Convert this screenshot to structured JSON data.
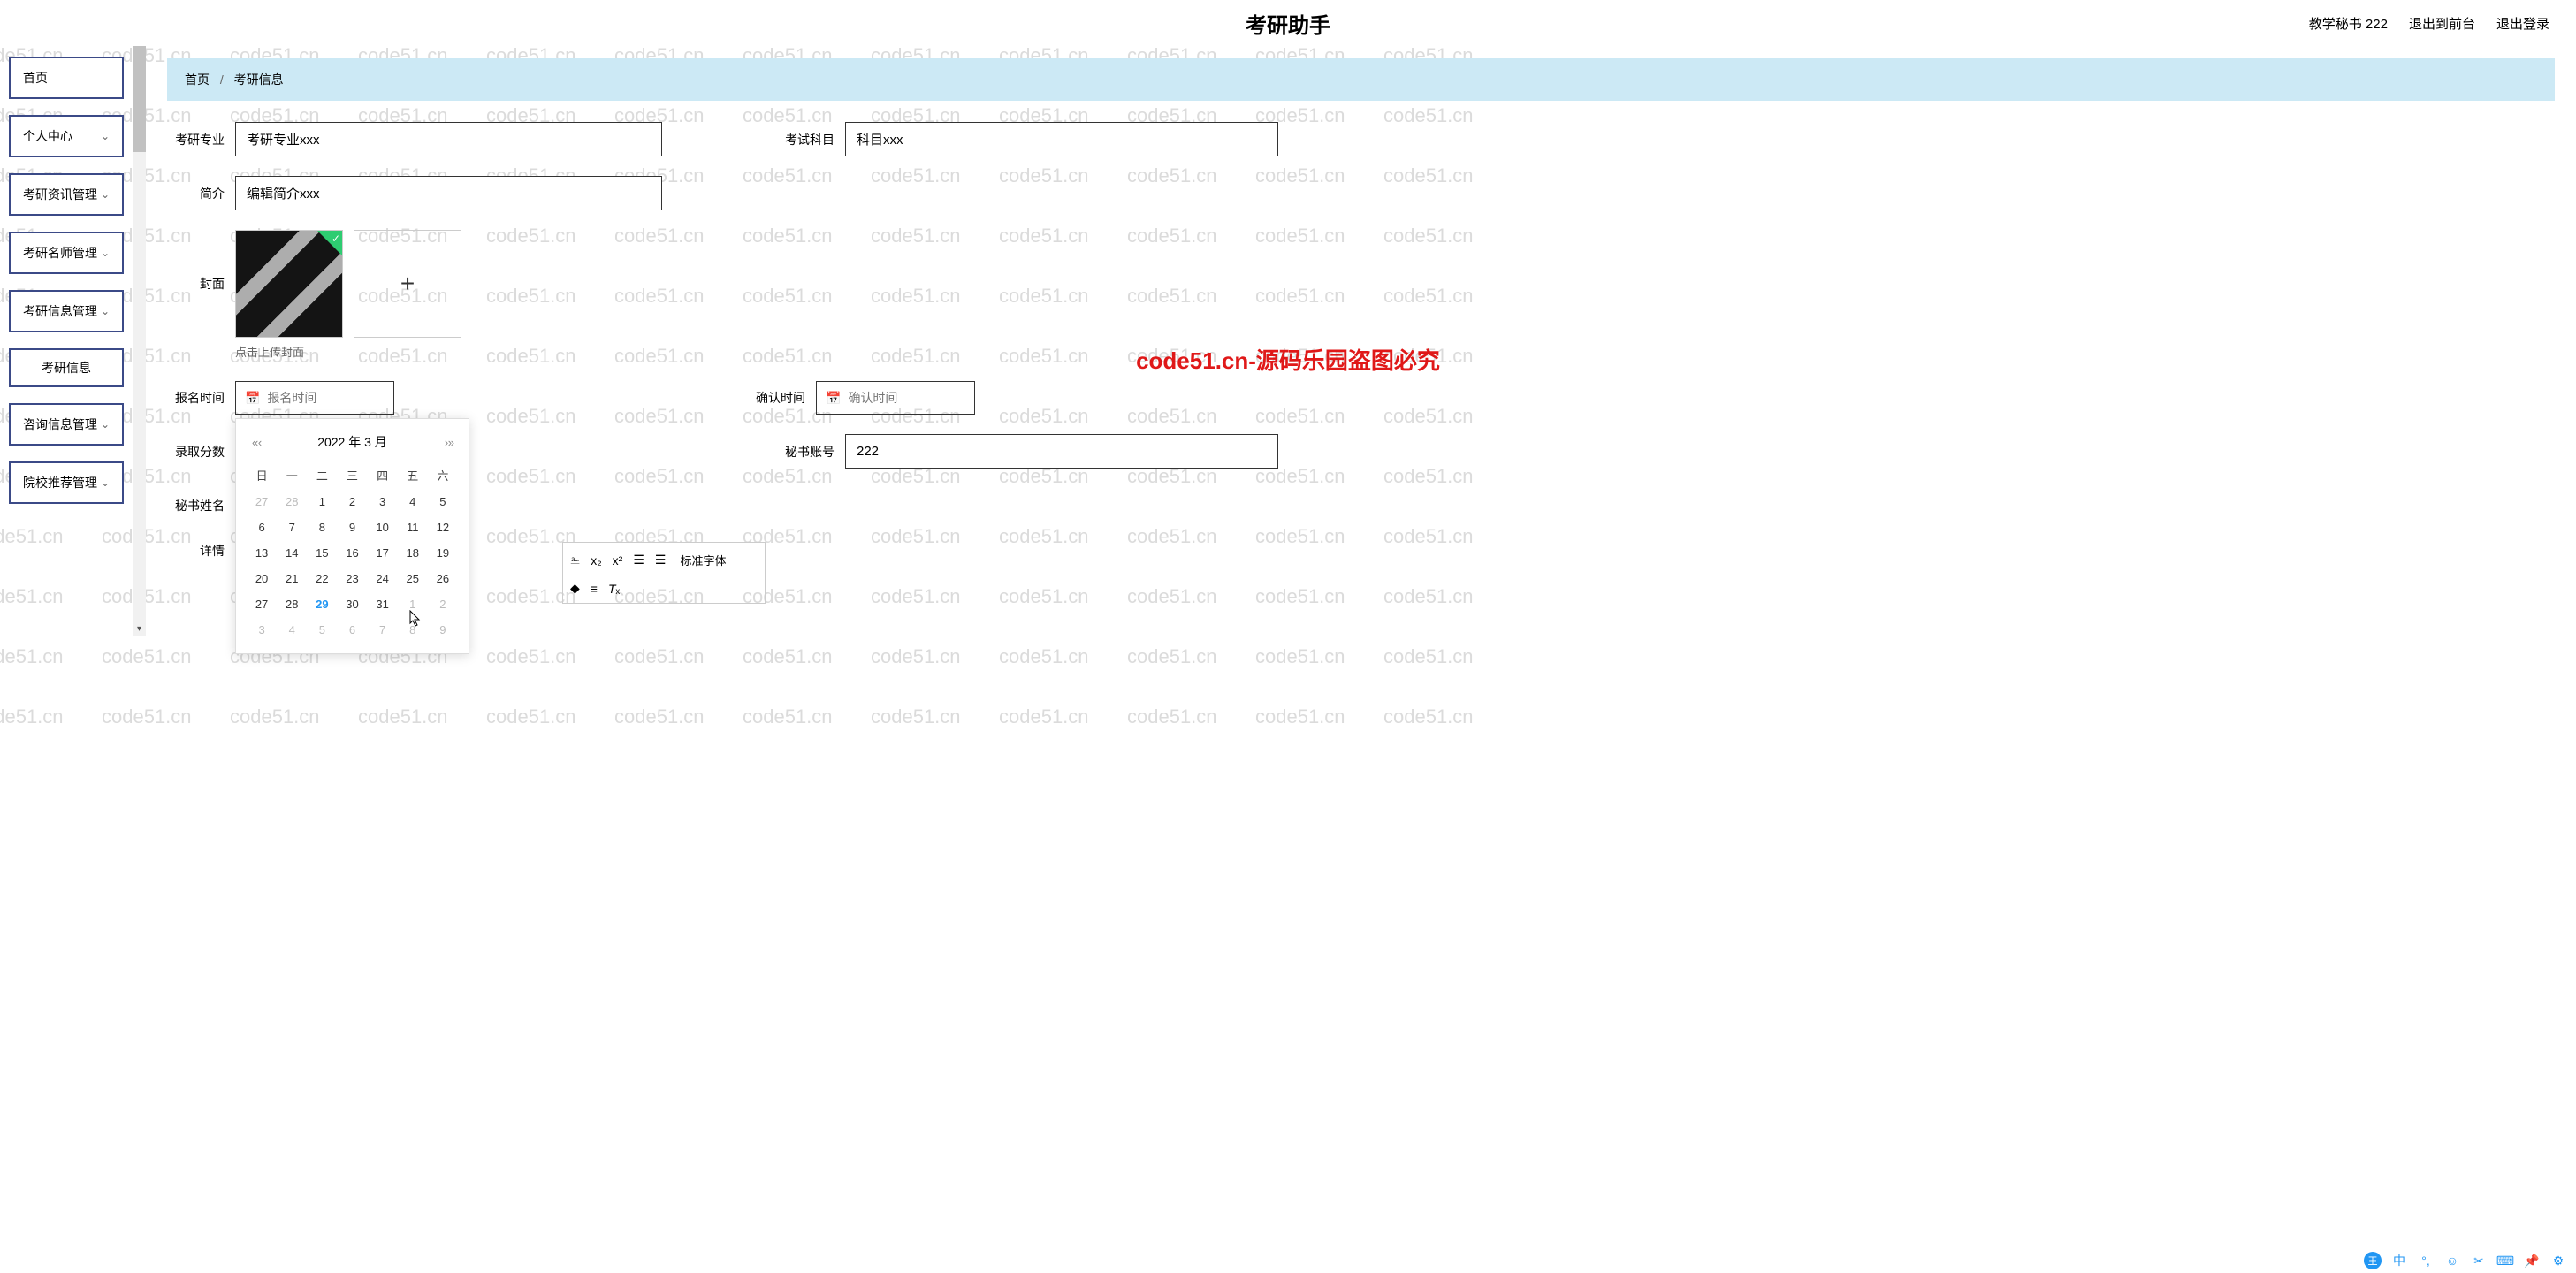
{
  "header": {
    "title": "考研助手",
    "user_role": "教学秘书 222",
    "back_link": "退出到前台",
    "logout_link": "退出登录"
  },
  "sidebar": {
    "items": [
      {
        "label": "首页",
        "has_children": false
      },
      {
        "label": "个人中心",
        "has_children": true
      },
      {
        "label": "考研资讯管理",
        "has_children": true
      },
      {
        "label": "考研名师管理",
        "has_children": true
      },
      {
        "label": "考研信息管理",
        "has_children": true
      },
      {
        "label": "考研信息",
        "is_sub": true
      },
      {
        "label": "咨询信息管理",
        "has_children": true
      },
      {
        "label": "院校推荐管理",
        "has_children": true
      }
    ]
  },
  "breadcrumb": {
    "root": "首页",
    "current": "考研信息"
  },
  "form": {
    "major_label": "考研专业",
    "major_value": "考研专业xxx",
    "subject_label": "考试科目",
    "subject_value": "科目xxx",
    "intro_label": "简介",
    "intro_value": "编辑简介xxx",
    "cover_label": "封面",
    "upload_tip": "点击上传封面",
    "signup_time_label": "报名时间",
    "signup_time_placeholder": "报名时间",
    "confirm_time_label": "确认时间",
    "confirm_time_placeholder": "确认时间",
    "score_label": "录取分数",
    "secretary_account_label": "秘书账号",
    "secretary_account_value": "222",
    "secretary_name_label": "秘书姓名",
    "detail_label": "详情"
  },
  "date_picker": {
    "title": "2022 年 3 月",
    "weekdays": [
      "日",
      "一",
      "二",
      "三",
      "四",
      "五",
      "六"
    ],
    "days": [
      {
        "d": 27,
        "o": true
      },
      {
        "d": 28,
        "o": true
      },
      {
        "d": 1
      },
      {
        "d": 2
      },
      {
        "d": 3
      },
      {
        "d": 4
      },
      {
        "d": 5
      },
      {
        "d": 6
      },
      {
        "d": 7
      },
      {
        "d": 8
      },
      {
        "d": 9
      },
      {
        "d": 10
      },
      {
        "d": 11
      },
      {
        "d": 12
      },
      {
        "d": 13
      },
      {
        "d": 14
      },
      {
        "d": 15
      },
      {
        "d": 16
      },
      {
        "d": 17
      },
      {
        "d": 18
      },
      {
        "d": 19
      },
      {
        "d": 20
      },
      {
        "d": 21
      },
      {
        "d": 22
      },
      {
        "d": 23
      },
      {
        "d": 24
      },
      {
        "d": 25
      },
      {
        "d": 26
      },
      {
        "d": 27
      },
      {
        "d": 28
      },
      {
        "d": 29,
        "t": true
      },
      {
        "d": 30
      },
      {
        "d": 31
      },
      {
        "d": 1,
        "o": true
      },
      {
        "d": 2,
        "o": true
      },
      {
        "d": 3,
        "o": true
      },
      {
        "d": 4,
        "o": true
      },
      {
        "d": 5,
        "o": true
      },
      {
        "d": 6,
        "o": true
      },
      {
        "d": 7,
        "o": true
      },
      {
        "d": 8,
        "o": true
      },
      {
        "d": 9,
        "o": true
      }
    ]
  },
  "editor": {
    "sub": "x₂",
    "sup": "x²",
    "font_select": "标准字体"
  },
  "watermark": {
    "text": "code51.cn",
    "red": "code51.cn-源码乐园盗图必究"
  },
  "ime": {
    "char": "王",
    "lang": "中"
  }
}
